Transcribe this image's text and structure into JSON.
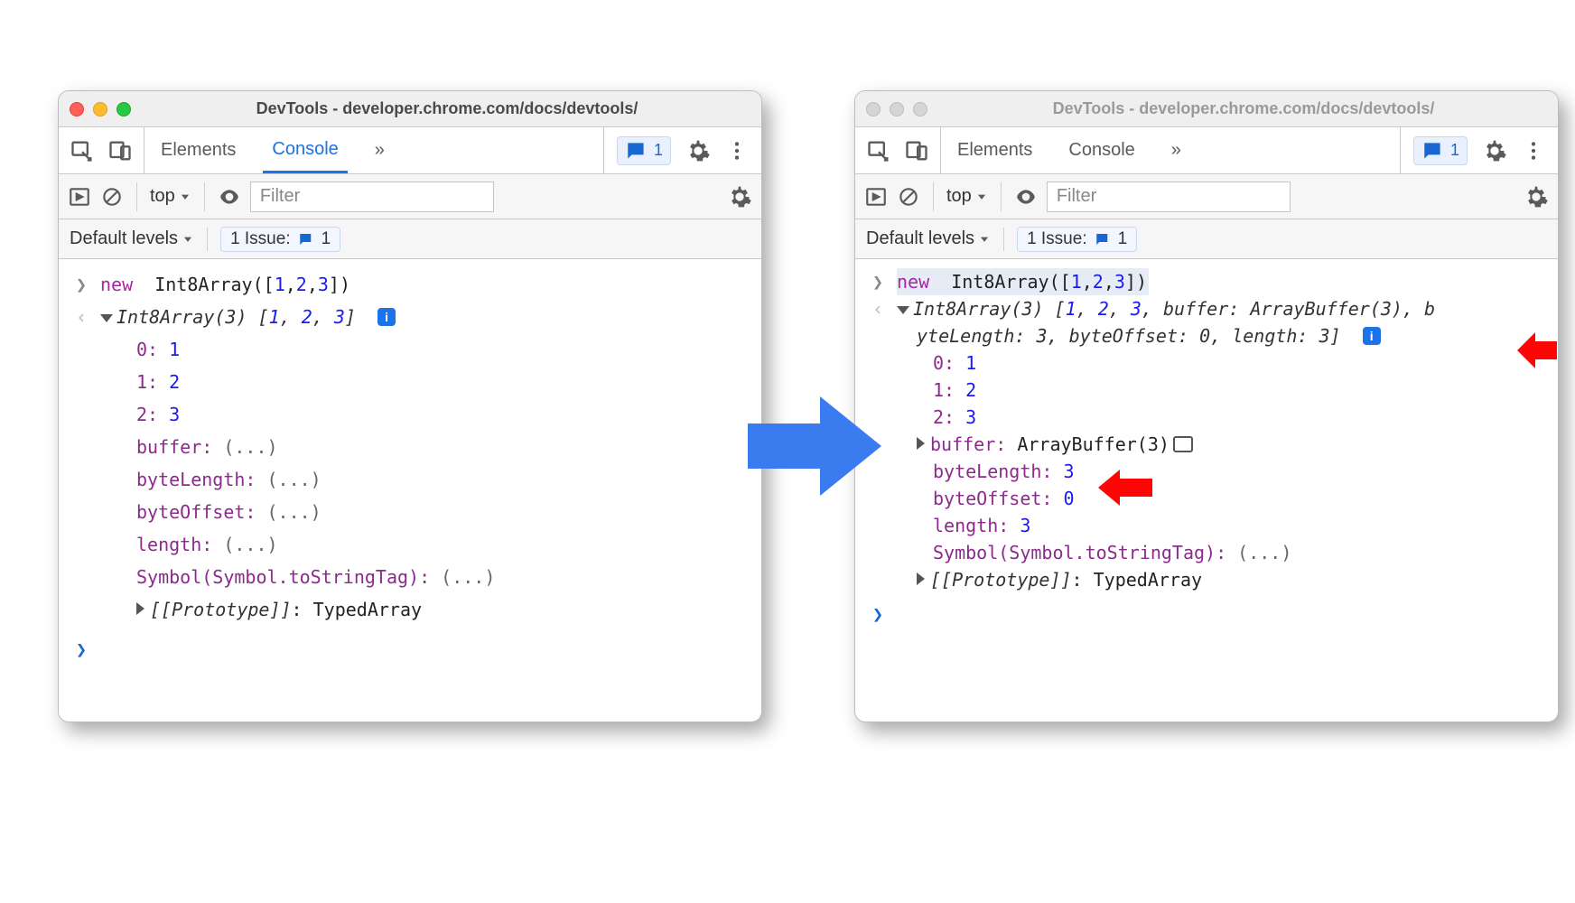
{
  "windows": {
    "left": {
      "title": "DevTools - developer.chrome.com/docs/devtools/",
      "traffic_active": true
    },
    "right": {
      "title": "DevTools - developer.chrome.com/docs/devtools/",
      "traffic_active": false
    }
  },
  "tabs": {
    "elements": "Elements",
    "console": "Console",
    "active": "Console"
  },
  "issue_count": "1",
  "context_selector": "top",
  "filter_placeholder": "Filter",
  "default_levels_label": "Default levels",
  "issue_row_label": "1 Issue:",
  "issue_pill": "1",
  "prompt": {
    "input": "new Int8Array([1,2,3])",
    "tokens": {
      "kw": "new",
      "ctor": "Int8Array",
      "args": "([1,2,3])",
      "nums": [
        "1",
        "2",
        "3"
      ]
    }
  },
  "left_output": {
    "preview": "Int8Array(3) [1, 2, 3]",
    "ctor": "Int8Array",
    "len": "3",
    "elems": [
      "1",
      "2",
      "3"
    ],
    "rows": [
      {
        "k": "0",
        "v": "1",
        "num": true
      },
      {
        "k": "1",
        "v": "2",
        "num": true
      },
      {
        "k": "2",
        "v": "3",
        "num": true
      },
      {
        "k": "buffer",
        "v": "(...)"
      },
      {
        "k": "byteLength",
        "v": "(...)"
      },
      {
        "k": "byteOffset",
        "v": "(...)"
      },
      {
        "k": "length",
        "v": "(...)"
      },
      {
        "k": "Symbol(Symbol.toStringTag)",
        "v": "(...)"
      }
    ],
    "proto_label": "[[Prototype]]",
    "proto_value": "TypedArray"
  },
  "right_output": {
    "preview_line1_a": "Int8Array(3) [",
    "preview_line1_b": ", buffer: ArrayBuffer(3), b",
    "preview_line2": "yteLength: 3, byteOffset: 0, length: 3]",
    "ctor": "Int8Array",
    "len": "3",
    "elems": [
      "1",
      "2",
      "3"
    ],
    "rows": [
      {
        "k": "0",
        "v": "1",
        "num": true
      },
      {
        "k": "1",
        "v": "2",
        "num": true
      },
      {
        "k": "2",
        "v": "3",
        "num": true
      }
    ],
    "buffer_label": "buffer",
    "buffer_value": "ArrayBuffer(3)",
    "tail": [
      {
        "k": "byteLength",
        "v": "3",
        "num": true
      },
      {
        "k": "byteOffset",
        "v": "0",
        "num": true
      },
      {
        "k": "length",
        "v": "3",
        "num": true
      },
      {
        "k": "Symbol(Symbol.toStringTag)",
        "v": "(...)"
      }
    ],
    "proto_label": "[[Prototype]]",
    "proto_value": "TypedArray"
  }
}
